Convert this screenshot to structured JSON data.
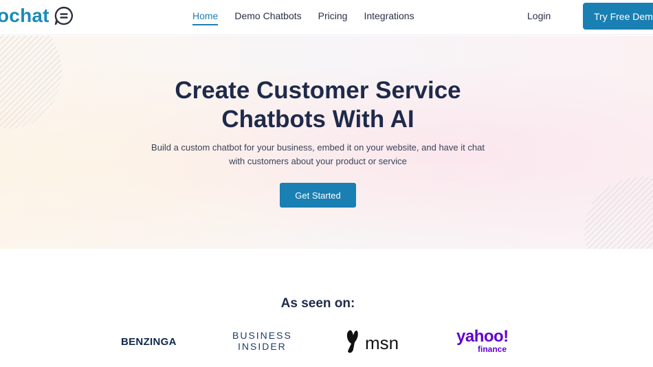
{
  "header": {
    "logo_text": "ochat",
    "logo_icon": "chat-bubble-icon",
    "nav": [
      {
        "label": "Home",
        "active": true
      },
      {
        "label": "Demo Chatbots",
        "active": false
      },
      {
        "label": "Pricing",
        "active": false
      },
      {
        "label": "Integrations",
        "active": false
      }
    ],
    "login_label": "Login",
    "cta_label": "Try Free Demo"
  },
  "hero": {
    "title_line1": "Create Customer Service",
    "title_line2": "Chatbots With AI",
    "subtitle_line1": "Build a custom chatbot for your business, embed it on your website, and have it chat",
    "subtitle_line2": "with customers about your product or service",
    "button_label": "Get Started"
  },
  "press": {
    "title": "As seen on:",
    "logos": {
      "benzinga": "BENZINGA",
      "business_insider_line1": "BUSINESS",
      "business_insider_line2": "INSIDER",
      "msn": "msn",
      "yahoo": "yahoo!",
      "yahoo_sub": "finance"
    }
  },
  "colors": {
    "brand": "#1a7fb2",
    "heading": "#1f2a4a",
    "yahoo": "#5f01d1"
  }
}
